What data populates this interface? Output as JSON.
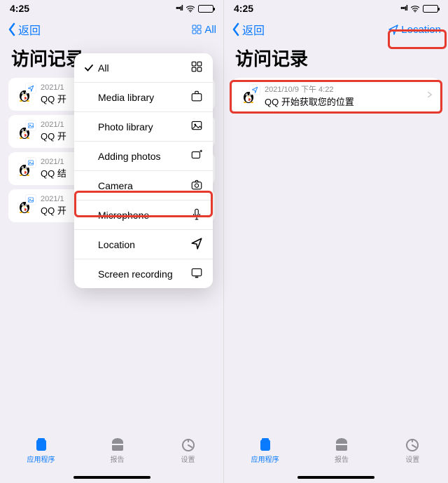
{
  "status": {
    "time": "4:25"
  },
  "nav": {
    "back": "返回",
    "filter_all": "All",
    "filter_location": "Location"
  },
  "page": {
    "title": "访问记录"
  },
  "left_records": [
    {
      "time": "2021/1",
      "title": "QQ 开",
      "badge": "location"
    },
    {
      "time": "2021/1",
      "title": "QQ 开",
      "badge": "photo"
    },
    {
      "time": "2021/1",
      "title": "QQ 结",
      "badge": "photo"
    },
    {
      "time": "2021/1",
      "title": "QQ 开",
      "badge": "photo"
    }
  ],
  "right_records": [
    {
      "time": "2021/10/9 下午 4:22",
      "title": "QQ 开始获取您的位置",
      "badge": "location"
    }
  ],
  "dropdown": [
    {
      "label": "All",
      "icon": "grid",
      "checked": true
    },
    {
      "label": "Media library",
      "icon": "briefcase"
    },
    {
      "label": "Photo library",
      "icon": "image"
    },
    {
      "label": "Adding photos",
      "icon": "image-plus"
    },
    {
      "label": "Camera",
      "icon": "camera"
    },
    {
      "label": "Microphone",
      "icon": "mic"
    },
    {
      "label": "Location",
      "icon": "location"
    },
    {
      "label": "Screen recording",
      "icon": "screen"
    }
  ],
  "tabs": {
    "apps": "应用程序",
    "reports": "报告",
    "settings": "设置"
  }
}
